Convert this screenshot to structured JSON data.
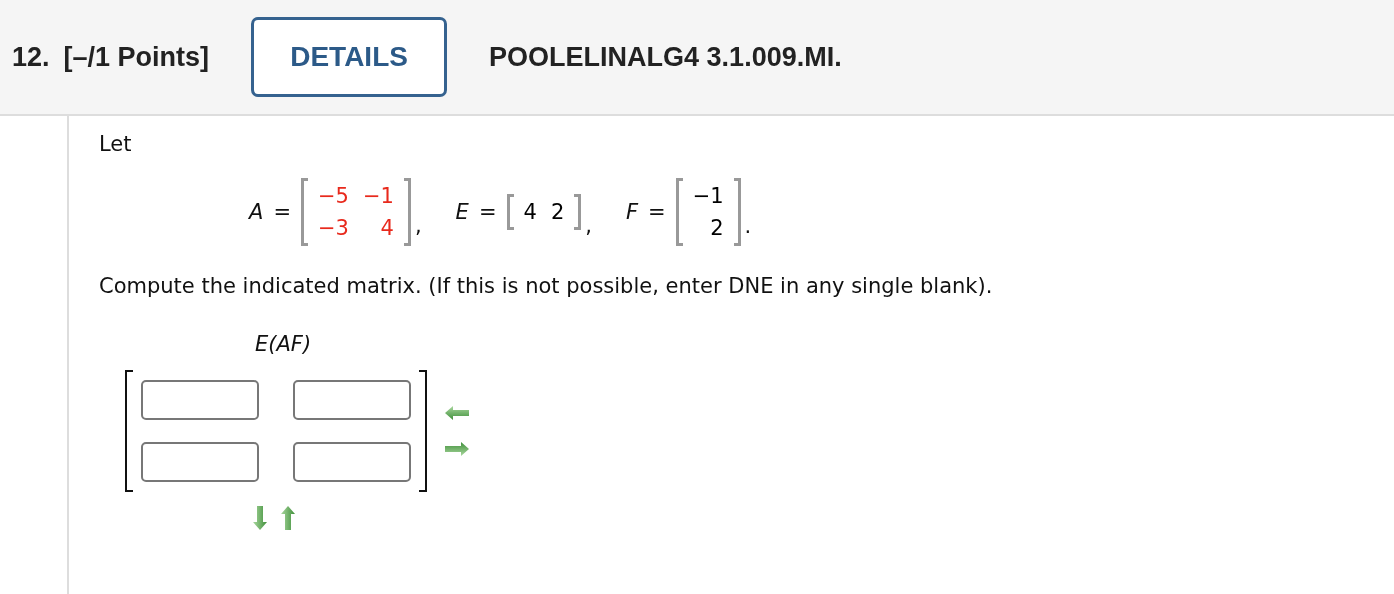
{
  "header": {
    "number": "12.",
    "points": "[–/1 Points]",
    "details_button": "DETAILS",
    "problem_id": "POOLELINALG4 3.1.009.MI."
  },
  "prompt": "Let",
  "matrices": [
    {
      "name": "A",
      "relation": "=",
      "rows": [
        [
          "−5",
          "−1"
        ],
        [
          "−3",
          "4"
        ]
      ],
      "color": "#e8291c",
      "punctuation": ","
    },
    {
      "name": "E",
      "relation": "=",
      "rows": [
        [
          "4",
          "2"
        ]
      ],
      "color": "#000000",
      "punctuation": ","
    },
    {
      "name": "F",
      "relation": "=",
      "rows": [
        [
          "−1"
        ],
        [
          "2"
        ]
      ],
      "color": "#000000",
      "punctuation": "."
    }
  ],
  "instruction": "Compute the indicated matrix. (If this is not possible, enter DNE in any single blank).",
  "expression": "E(AF)",
  "answer_fields": [
    [
      {
        "kind": "blank"
      },
      {
        "kind": "blank"
      }
    ],
    [
      {
        "kind": "blank"
      },
      {
        "kind": "blank"
      }
    ]
  ]
}
